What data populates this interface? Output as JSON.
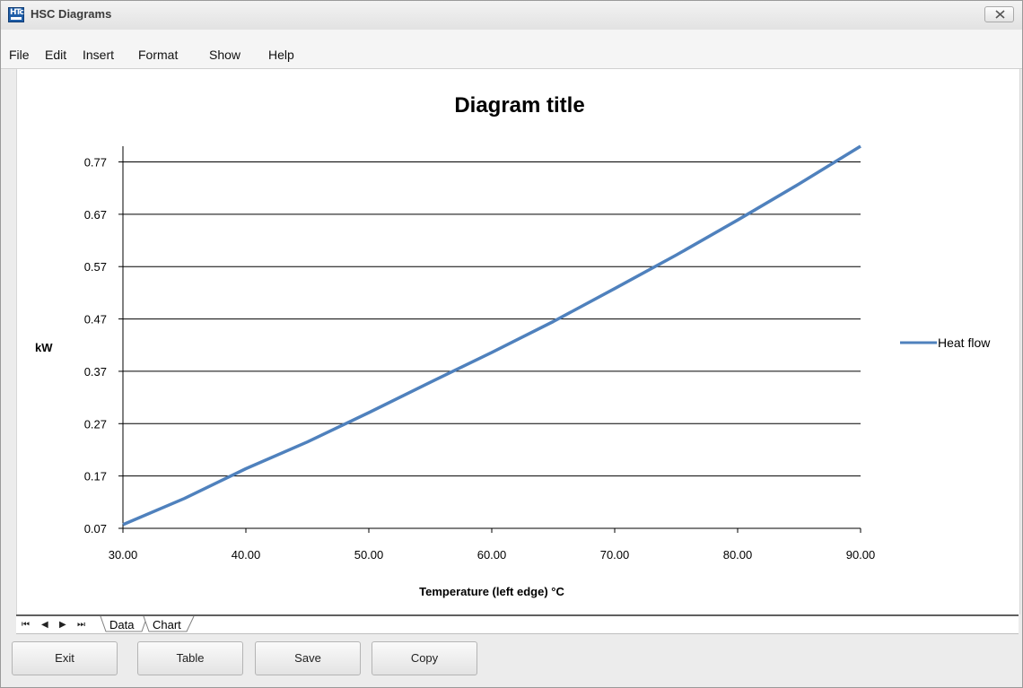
{
  "window": {
    "title": "HSC Diagrams",
    "logo_text": "HTc"
  },
  "menu": {
    "items": [
      "File",
      "Edit",
      "Insert",
      "Format",
      "Show",
      "Help"
    ]
  },
  "chart_data": {
    "type": "line",
    "title": "Diagram title",
    "xlabel": "Temperature (left edge) °C",
    "ylabel": "kW",
    "x_ticks": [
      "30.00",
      "40.00",
      "50.00",
      "60.00",
      "70.00",
      "80.00",
      "90.00"
    ],
    "y_ticks": [
      "0.07",
      "0.17",
      "0.27",
      "0.37",
      "0.47",
      "0.57",
      "0.67",
      "0.77"
    ],
    "xlim": [
      30,
      90
    ],
    "ylim": [
      0.07,
      0.8
    ],
    "grid": "horizontal",
    "legend_position": "right",
    "series": [
      {
        "name": "Heat flow",
        "color": "#4f81bd",
        "x": [
          30,
          35,
          40,
          45,
          50,
          55,
          60,
          65,
          70,
          75,
          80,
          85,
          90
        ],
        "y": [
          0.077,
          0.127,
          0.184,
          0.235,
          0.291,
          0.349,
          0.406,
          0.465,
          0.528,
          0.592,
          0.659,
          0.728,
          0.8
        ]
      }
    ]
  },
  "tabs": {
    "items": [
      "Data",
      "Chart"
    ],
    "active": "Chart"
  },
  "buttons": {
    "exit": "Exit",
    "table": "Table",
    "save": "Save",
    "copy": "Copy"
  }
}
